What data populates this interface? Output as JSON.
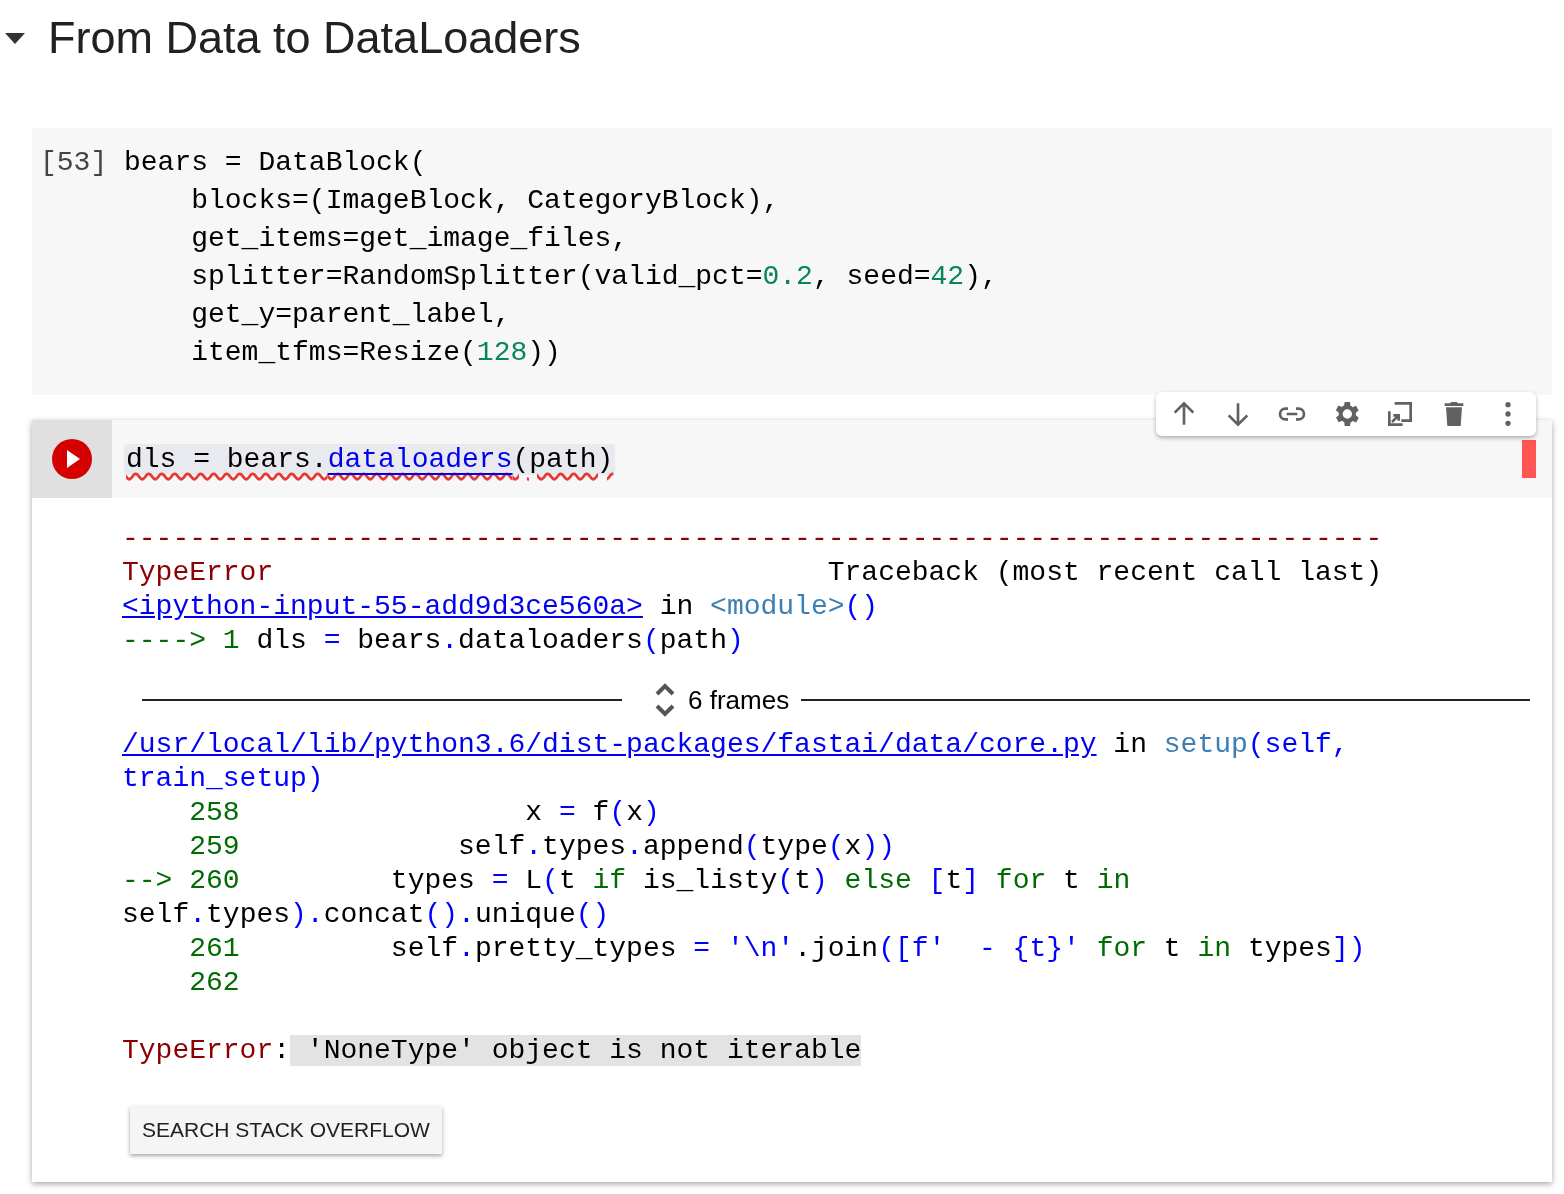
{
  "section": {
    "title": "From Data to DataLoaders",
    "expanded": true
  },
  "code_cell": {
    "prompt": "[53]",
    "lines": [
      [
        {
          "text": "bears = DataBlock("
        }
      ],
      [
        {
          "text": "    blocks=(ImageBlock, CategoryBlock),"
        }
      ],
      [
        {
          "text": "    get_items=get_image_files,"
        }
      ],
      [
        {
          "text": "    splitter=RandomSplitter(valid_pct="
        },
        {
          "text": "0.2",
          "kind": "number"
        },
        {
          "text": ", seed="
        },
        {
          "text": "42",
          "kind": "number"
        },
        {
          "text": "),"
        }
      ],
      [
        {
          "text": "    get_y=parent_label,"
        }
      ],
      [
        {
          "text": "    item_tfms=Resize("
        },
        {
          "text": "128",
          "kind": "number"
        },
        {
          "text": "))"
        }
      ]
    ]
  },
  "active_cell": {
    "code": [
      {
        "text": "dls = bears."
      },
      {
        "text": "dataloaders",
        "kind": "link"
      },
      {
        "text": "(path)"
      }
    ],
    "has_error": true,
    "output": {
      "header": [
        [
          {
            "text": "---------------------------------------------------------------------------",
            "kind": "error"
          }
        ],
        [
          {
            "text": "TypeError",
            "kind": "error"
          },
          {
            "text": "                                 Traceback (most recent call last)"
          }
        ],
        [
          {
            "text": "<ipython-input-55-add9d3ce560a>",
            "kind": "link"
          },
          {
            "text": " in "
          },
          {
            "text": "<module>",
            "kind": "func"
          },
          {
            "text": "()",
            "kind": "op"
          }
        ],
        [
          {
            "text": "----> 1",
            "kind": "green"
          },
          {
            "text": " dls "
          },
          {
            "text": "=",
            "kind": "op"
          },
          {
            "text": " bears"
          },
          {
            "text": ".",
            "kind": "op"
          },
          {
            "text": "dataloaders"
          },
          {
            "text": "(",
            "kind": "op"
          },
          {
            "text": "path"
          },
          {
            "text": ")",
            "kind": "op"
          }
        ]
      ],
      "frames_label": "6 frames",
      "frames": [
        [
          {
            "text": "/usr/local/lib/python3.6/dist-packages/fastai/data/core.py",
            "kind": "link"
          },
          {
            "text": " in "
          },
          {
            "text": "setup",
            "kind": "func"
          },
          {
            "text": "(self,",
            "kind": "op"
          }
        ],
        [
          {
            "text": "train_setup)",
            "kind": "op"
          }
        ],
        [
          {
            "text": "    258",
            "kind": "green"
          },
          {
            "text": "                 x "
          },
          {
            "text": "=",
            "kind": "op"
          },
          {
            "text": " f"
          },
          {
            "text": "(",
            "kind": "op"
          },
          {
            "text": "x"
          },
          {
            "text": ")",
            "kind": "op"
          }
        ],
        [
          {
            "text": "    259",
            "kind": "green"
          },
          {
            "text": "             self"
          },
          {
            "text": ".",
            "kind": "op"
          },
          {
            "text": "types"
          },
          {
            "text": ".",
            "kind": "op"
          },
          {
            "text": "append"
          },
          {
            "text": "(",
            "kind": "op"
          },
          {
            "text": "type"
          },
          {
            "text": "(",
            "kind": "op"
          },
          {
            "text": "x"
          },
          {
            "text": "))",
            "kind": "op"
          }
        ],
        [
          {
            "text": "--> 260",
            "kind": "green"
          },
          {
            "text": "         types "
          },
          {
            "text": "=",
            "kind": "op"
          },
          {
            "text": " L"
          },
          {
            "text": "(",
            "kind": "op"
          },
          {
            "text": "t "
          },
          {
            "text": "if",
            "kind": "green"
          },
          {
            "text": " is_listy"
          },
          {
            "text": "(",
            "kind": "op"
          },
          {
            "text": "t"
          },
          {
            "text": ") ",
            "kind": "op"
          },
          {
            "text": "else",
            "kind": "green"
          },
          {
            "text": " [",
            "kind": "op"
          },
          {
            "text": "t"
          },
          {
            "text": "] ",
            "kind": "op"
          },
          {
            "text": "for",
            "kind": "green"
          },
          {
            "text": " t "
          },
          {
            "text": "in",
            "kind": "green"
          }
        ],
        [
          {
            "text": "self"
          },
          {
            "text": ".",
            "kind": "op"
          },
          {
            "text": "types"
          },
          {
            "text": ").",
            "kind": "op"
          },
          {
            "text": "concat"
          },
          {
            "text": "().",
            "kind": "op"
          },
          {
            "text": "unique"
          },
          {
            "text": "()",
            "kind": "op"
          }
        ],
        [
          {
            "text": "    261",
            "kind": "green"
          },
          {
            "text": "         self"
          },
          {
            "text": ".",
            "kind": "op"
          },
          {
            "text": "pretty_types "
          },
          {
            "text": "= ",
            "kind": "op"
          },
          {
            "text": "'\\n'",
            "kind": "string"
          },
          {
            "text": "."
          },
          {
            "text": "join"
          },
          {
            "text": "([",
            "kind": "op"
          },
          {
            "text": "f'  - {t}' ",
            "kind": "string"
          },
          {
            "text": "for",
            "kind": "green"
          },
          {
            "text": " t "
          },
          {
            "text": "in",
            "kind": "green"
          },
          {
            "text": " types"
          },
          {
            "text": "])",
            "kind": "op"
          }
        ],
        [
          {
            "text": "    262",
            "kind": "green"
          }
        ]
      ],
      "error": [
        {
          "text": "TypeError",
          "kind": "error"
        },
        {
          "text": ":"
        },
        {
          "text": " 'NoneType' object is not iterable",
          "kind": "highlight"
        }
      ],
      "button": "SEARCH STACK OVERFLOW"
    }
  }
}
